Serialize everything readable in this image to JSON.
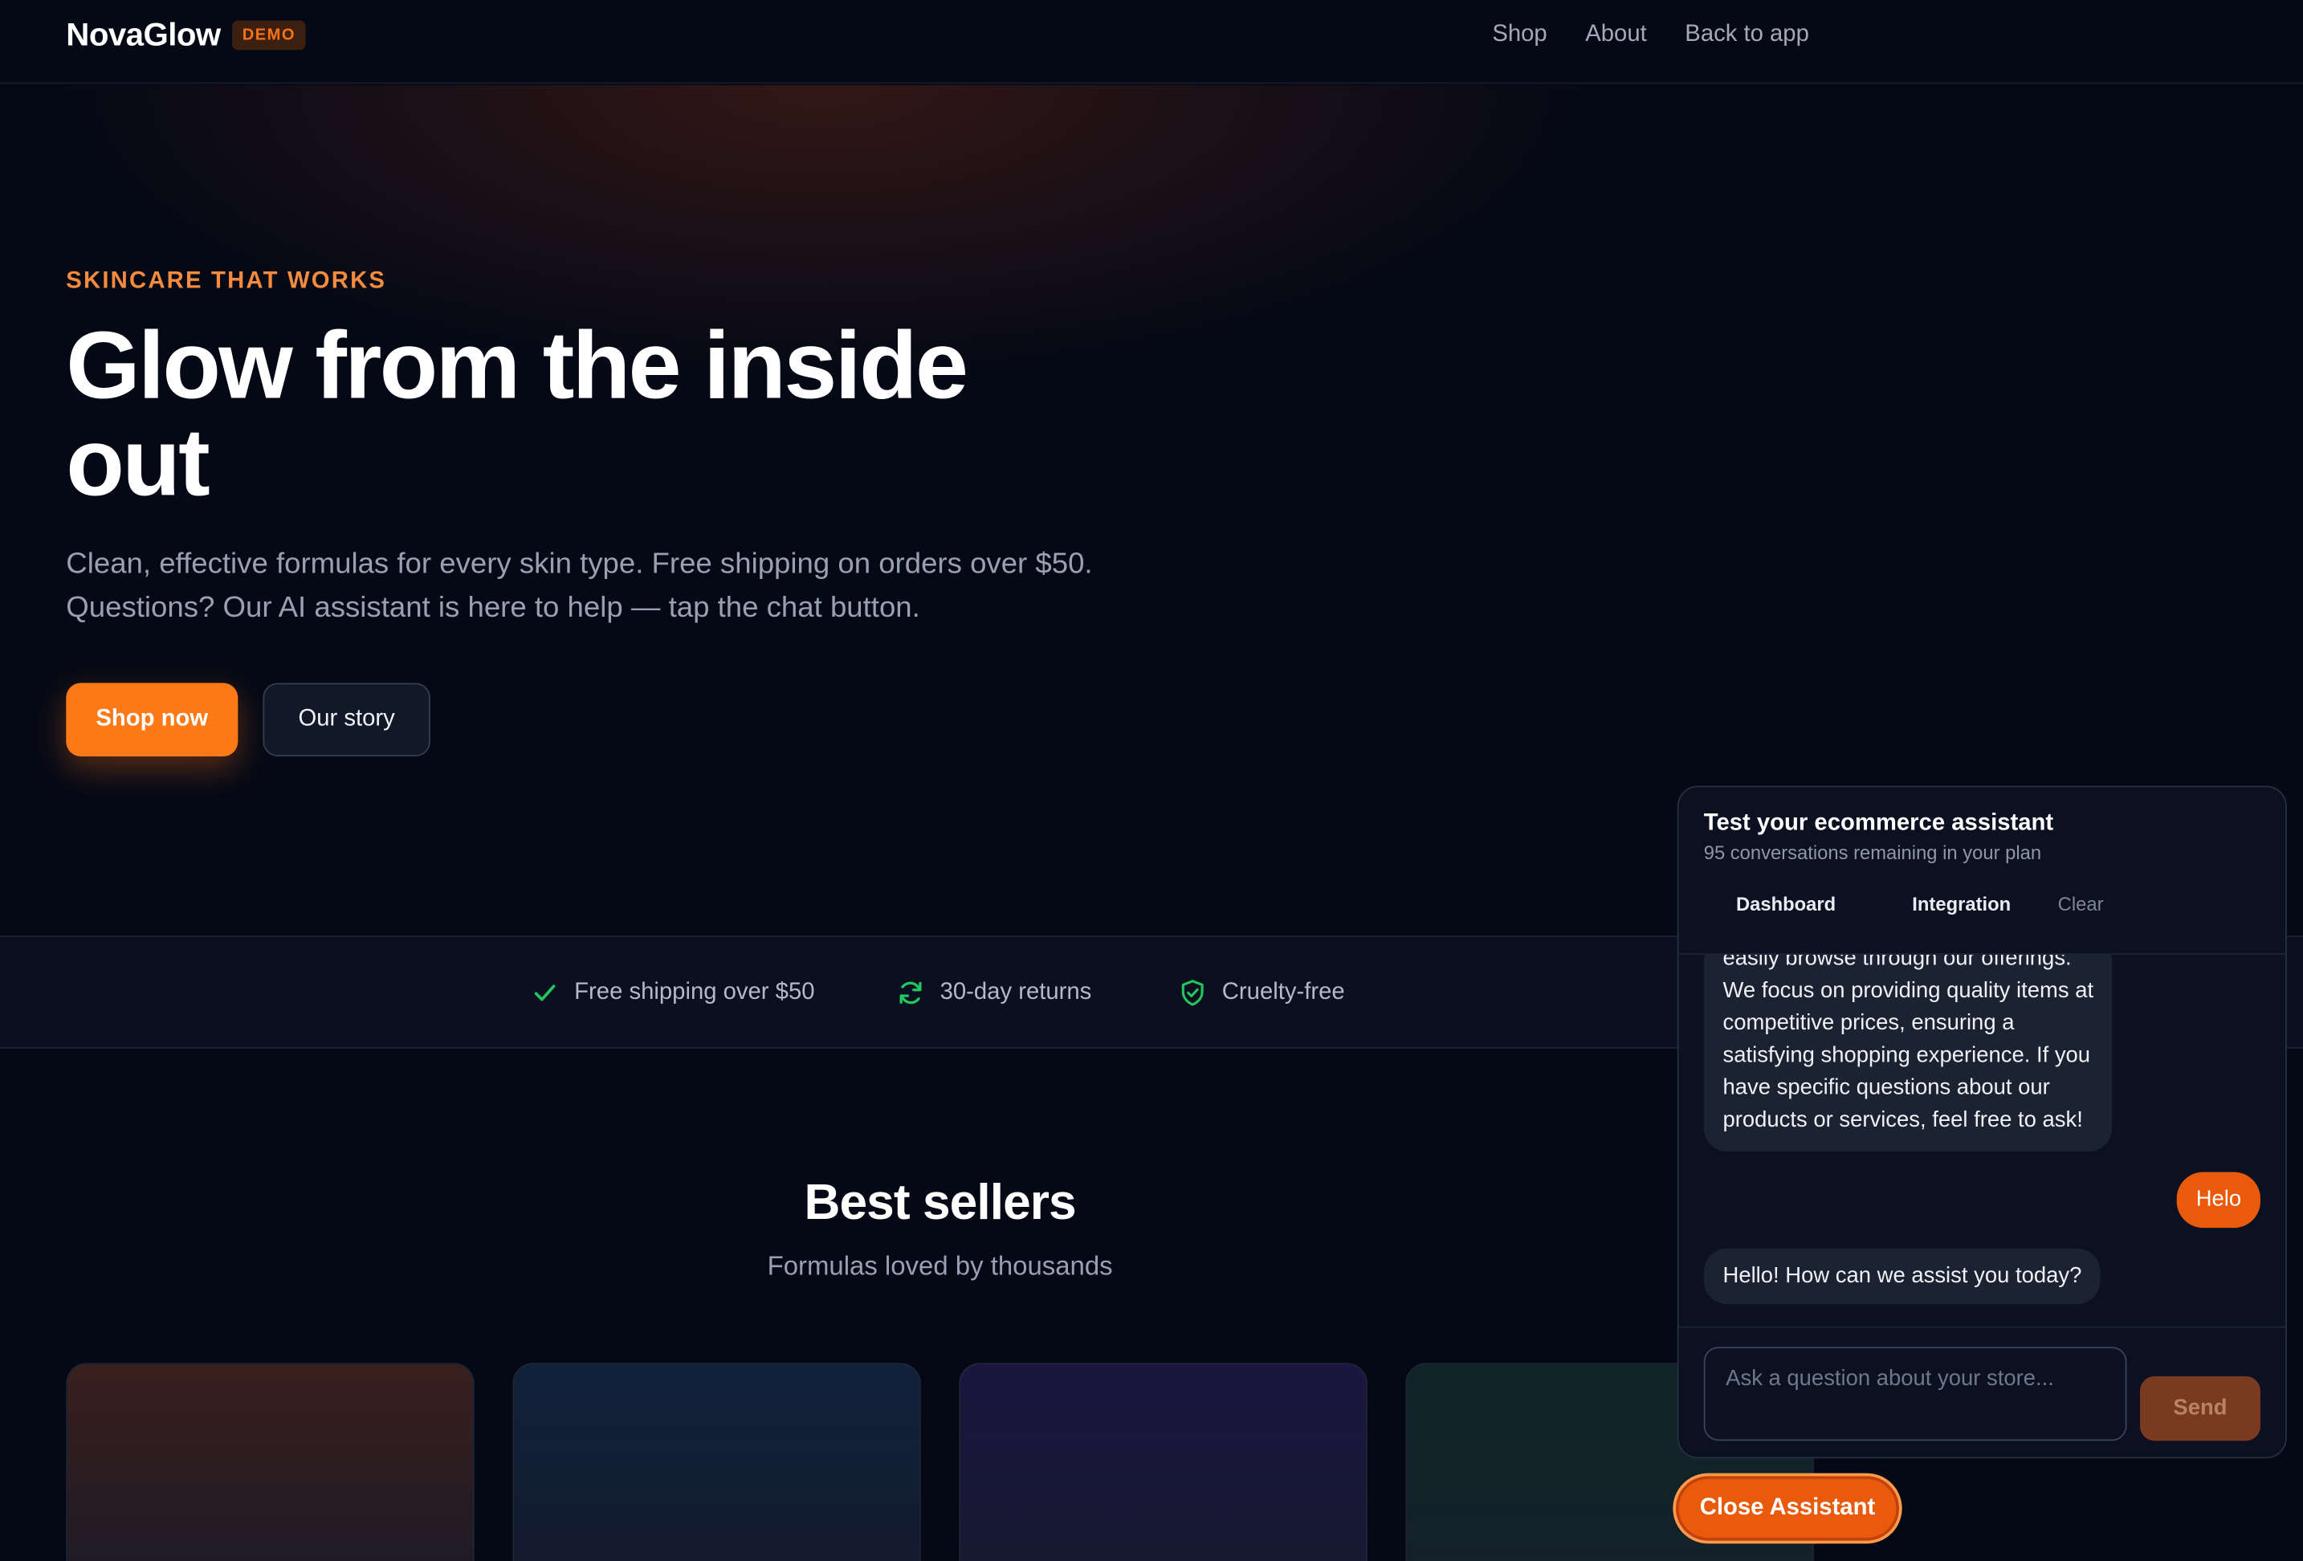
{
  "nav": {
    "brand": "NovaGlow",
    "badge": "DEMO",
    "links": [
      "Shop",
      "About",
      "Back to app"
    ]
  },
  "hero": {
    "eyebrow": "SKINCARE THAT WORKS",
    "title": "Glow from the inside out",
    "subtitle": "Clean, effective formulas for every skin type. Free shipping on orders over $50. Questions? Our AI assistant is here to help — tap the chat button.",
    "primary_button": "Shop now",
    "secondary_button": "Our story"
  },
  "features": [
    {
      "icon": "check-icon",
      "label": "Free shipping over $50"
    },
    {
      "icon": "refresh-icon",
      "label": "30-day returns"
    },
    {
      "icon": "shield-check-icon",
      "label": "Cruelty-free"
    }
  ],
  "best_sellers": {
    "title": "Best sellers",
    "subtitle": "Formulas loved by thousands"
  },
  "chat": {
    "title": "Test your ecommerce assistant",
    "plan": "95 conversations remaining in your plan",
    "tabs": [
      "Dashboard",
      "Integration"
    ],
    "clear": "Clear",
    "messages": [
      {
        "role": "assistant",
        "text_lines": [
          "easily browse through our offerings.",
          "We focus on providing quality items at",
          "competitive prices, ensuring a",
          "satisfying shopping experience. If you",
          "have specific questions about our",
          "products or services, feel free to ask!"
        ]
      },
      {
        "role": "user",
        "text": "Helo"
      },
      {
        "role": "assistant",
        "text": "Hello! How can we assist you today?"
      }
    ],
    "input_placeholder": "Ask a question about your store...",
    "send": "Send"
  },
  "close_assistant": "Close Assistant",
  "colors": {
    "background": "#050916",
    "accent": "#f97316",
    "feature_icon": "#22c55e"
  }
}
